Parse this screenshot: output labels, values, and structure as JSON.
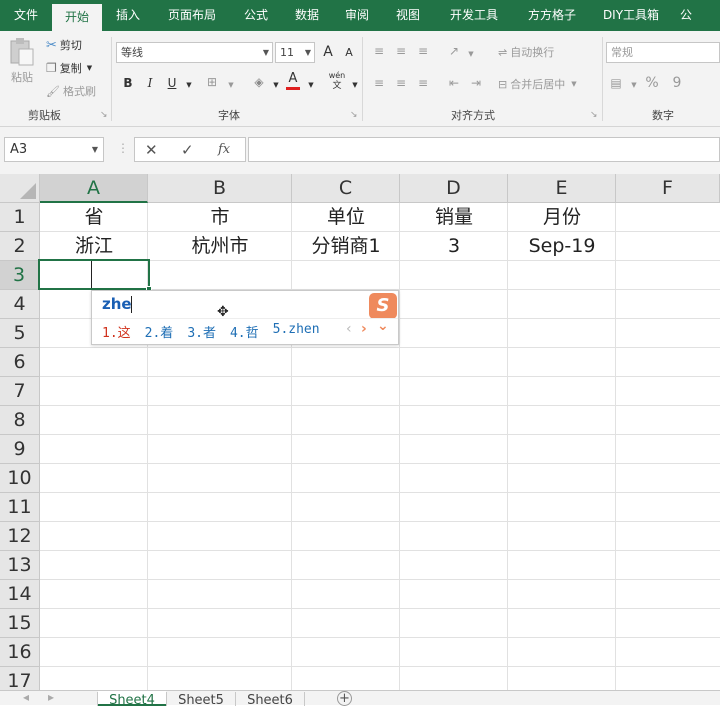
{
  "ribbon_tabs": [
    {
      "label": "文件",
      "active": false
    },
    {
      "label": "开始",
      "active": true
    },
    {
      "label": "插入",
      "active": false
    },
    {
      "label": "页面布局",
      "active": false
    },
    {
      "label": "公式",
      "active": false
    },
    {
      "label": "数据",
      "active": false
    },
    {
      "label": "审阅",
      "active": false
    },
    {
      "label": "视图",
      "active": false
    },
    {
      "label": "开发工具",
      "active": false
    },
    {
      "label": "方方格子",
      "active": false
    },
    {
      "label": "DIY工具箱",
      "active": false
    },
    {
      "label": "公",
      "active": false
    }
  ],
  "clipboard": {
    "paste": "粘贴",
    "cut": "剪切",
    "copy": "复制",
    "format_painter": "格式刷",
    "group_label": "剪贴板"
  },
  "font": {
    "name": "等线",
    "size": "11",
    "bold": "B",
    "italic": "I",
    "underline": "U",
    "grow": "A",
    "shrink": "A",
    "color_letter": "A",
    "wen": "wén",
    "wen_sub": "文",
    "group_label": "字体"
  },
  "alignment": {
    "wrap": "自动换行",
    "merge": "合并后居中",
    "group_label": "对齐方式"
  },
  "number": {
    "format": "常规",
    "percent": "%",
    "comma": "9",
    "group_label": "数字"
  },
  "formula_bar": {
    "name_box": "A3",
    "cancel": "✕",
    "enter": "✓",
    "fx": "fx",
    "value": ""
  },
  "columns": [
    "A",
    "B",
    "C",
    "D",
    "E",
    "F"
  ],
  "rows": [
    "1",
    "2",
    "3",
    "4",
    "5",
    "6",
    "7",
    "8",
    "9",
    "10",
    "11",
    "12",
    "13",
    "14",
    "15",
    "16",
    "17"
  ],
  "cells": {
    "A1": "省",
    "B1": "市",
    "C1": "单位",
    "D1": "销量",
    "E1": "月份",
    "A2": "浙江",
    "B2": "杭州市",
    "C2": "分销商1",
    "D2": "3",
    "E2": "Sep-19"
  },
  "selected_cell": "A3",
  "ime": {
    "input": "zhe",
    "candidates": [
      "1.这",
      "2.着",
      "3.者",
      "4.哲",
      "5.zhen"
    ],
    "prev": "‹",
    "next": "›",
    "expand": "⌄",
    "logo": "S",
    "brand_color": "#ef8a5d"
  },
  "sheets": [
    {
      "label": "Sheet4",
      "active": true
    },
    {
      "label": "Sheet5",
      "active": false
    },
    {
      "label": "Sheet6",
      "active": false
    }
  ],
  "add_sheet": "+",
  "accent_color": "#217346"
}
